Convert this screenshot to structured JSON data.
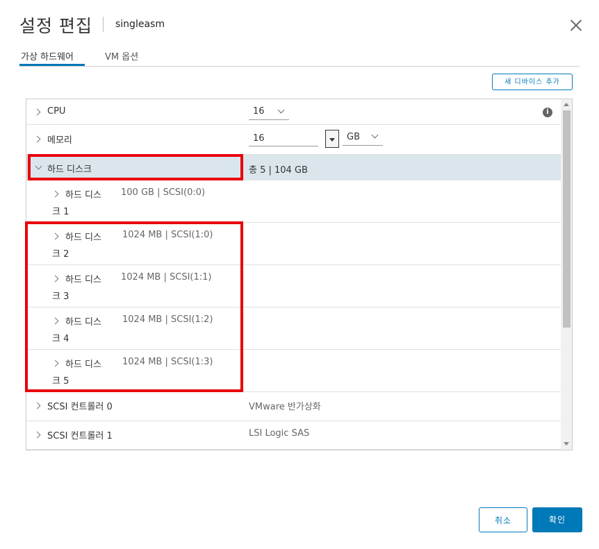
{
  "dialog": {
    "title": "설정 편집",
    "vm_name": "singleasm",
    "close_icon": "close-icon"
  },
  "tabs": [
    {
      "label": "가상 하드웨어",
      "active": true
    },
    {
      "label": "VM 옵션",
      "active": false
    }
  ],
  "toolbar": {
    "add_device_label": "새 디바이스 추가"
  },
  "hardware": {
    "cpu": {
      "label": "CPU",
      "value": "16"
    },
    "memory": {
      "label": "메모리",
      "value": "16",
      "unit": "GB"
    },
    "hard_disks": {
      "label": "하드 디스크",
      "summary": "총 5 | 104 GB",
      "disks": [
        {
          "label_line1": "하드 디스",
          "label_line2": "크 1",
          "detail": "100 GB | SCSI(0:0)"
        },
        {
          "label_line1": "하드 디스",
          "label_line2": "크 2",
          "detail": "1024 MB | SCSI(1:0)"
        },
        {
          "label_line1": "하드 디스",
          "label_line2": "크 3",
          "detail": "1024 MB | SCSI(1:1)"
        },
        {
          "label_line1": "하드 디스",
          "label_line2": "크 4",
          "detail": "1024 MB | SCSI(1:2)"
        },
        {
          "label_line1": "하드 디스",
          "label_line2": "크 5",
          "detail": "1024 MB | SCSI(1:3)"
        }
      ]
    },
    "controllers": [
      {
        "label": "SCSI 컨트롤러 0",
        "value": "VMware 반가상화"
      },
      {
        "label": "SCSI 컨트롤러 1",
        "value": "LSI Logic SAS"
      }
    ]
  },
  "footer": {
    "cancel_label": "취소",
    "ok_label": "확인"
  },
  "colors": {
    "accent": "#0079b8",
    "highlight": "#e8000b",
    "selected_row": "#dbe5ec"
  }
}
